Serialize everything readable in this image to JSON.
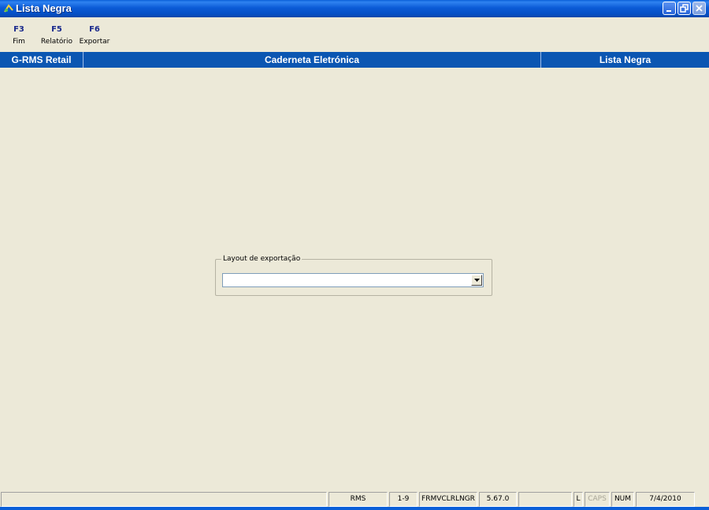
{
  "window": {
    "title": "Lista Negra",
    "icon": "app-icon",
    "controls": [
      "minimize-icon",
      "restore-icon",
      "close-icon"
    ]
  },
  "toolbar": {
    "items": [
      {
        "key": "F3",
        "label": "Fim"
      },
      {
        "key": "F5",
        "label": "Relatório"
      },
      {
        "key": "F6",
        "label": "Exportar"
      }
    ]
  },
  "header": {
    "app": "G-RMS Retail",
    "module": "Caderneta Eletrónica",
    "screen": "Lista Negra"
  },
  "export_group": {
    "label": "Layout de exportação",
    "selected_value": ""
  },
  "statusbar": {
    "panels": [
      "",
      "RMS",
      "1-9",
      "FRMVCLRLNGR",
      "5.67.0",
      "",
      "L",
      "CAPS",
      "NUM",
      "7/4/2010"
    ]
  },
  "colors": {
    "header_bg": "#0B56B2",
    "window_bg": "#ECE9D8",
    "titlebar": "#0A5FD8"
  }
}
